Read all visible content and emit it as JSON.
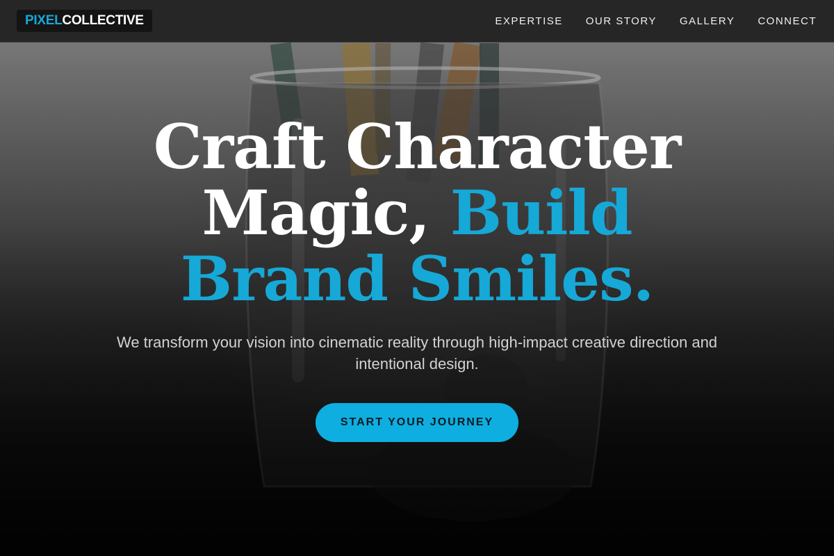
{
  "brand": {
    "logo_accent": "PIXEL",
    "logo_rest": "COLLECTIVE"
  },
  "nav": {
    "items": [
      {
        "label": "EXPERTISE"
      },
      {
        "label": "OUR STORY"
      },
      {
        "label": "GALLERY"
      },
      {
        "label": "CONNECT"
      }
    ]
  },
  "hero": {
    "headline_white_1": "Craft Character",
    "headline_white_2": "Magic, ",
    "headline_accent_1": "Build",
    "headline_accent_2": "Brand Smiles.",
    "subtext": "We transform your vision into cinematic reality through high-impact creative direction and intentional design.",
    "cta_label": "START YOUR JOURNEY"
  },
  "colors": {
    "accent": "#16a8d6",
    "nav_background": "#222222",
    "cta_background": "#0eaee0",
    "text_light": "#ffffff"
  },
  "icons": []
}
